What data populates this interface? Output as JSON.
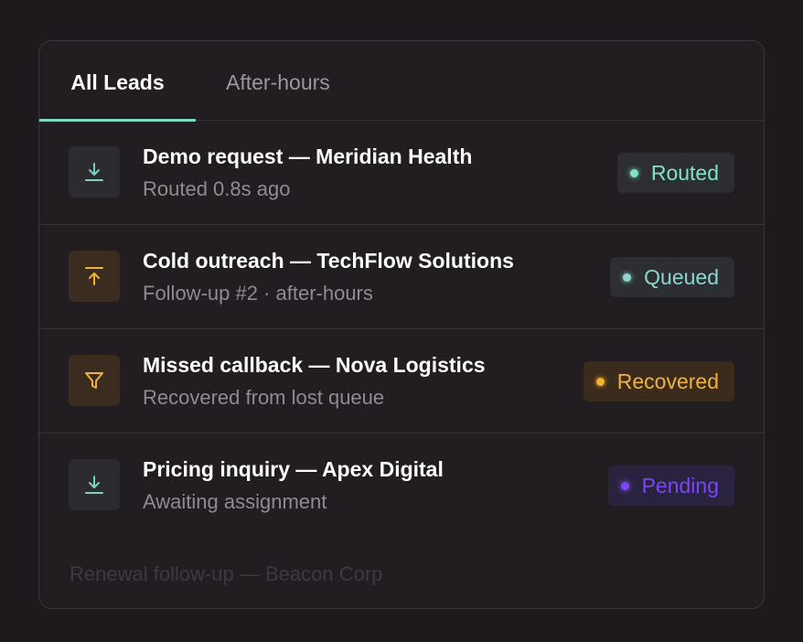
{
  "tabs": [
    {
      "label": "All Leads",
      "active": true
    },
    {
      "label": "After-hours",
      "active": false
    }
  ],
  "colors": {
    "background": "#1d191c",
    "panel": "#211d21",
    "accent": "#7fd9c4",
    "routed": "#7fe3c6",
    "queued": "#8cd6cf",
    "recovered": "#f2b233",
    "pending": "#7b46f5"
  },
  "leads": [
    {
      "icon": "download-icon",
      "title": "Demo request — Meridian Health",
      "subtitle": "Routed 0.8s ago",
      "status": "Routed"
    },
    {
      "icon": "upload-icon",
      "title": "Cold outreach — TechFlow Solutions",
      "subtitle": "Follow-up #2 · after-hours",
      "status": "Queued"
    },
    {
      "icon": "filter-icon",
      "title": "Missed callback — Nova Logistics",
      "subtitle": "Recovered from lost queue",
      "status": "Recovered"
    },
    {
      "icon": "download-icon",
      "title": "Pricing inquiry — Apex Digital",
      "subtitle": "Awaiting assignment",
      "status": "Pending"
    }
  ],
  "faded_item": "Renewal follow-up — Beacon Corp"
}
